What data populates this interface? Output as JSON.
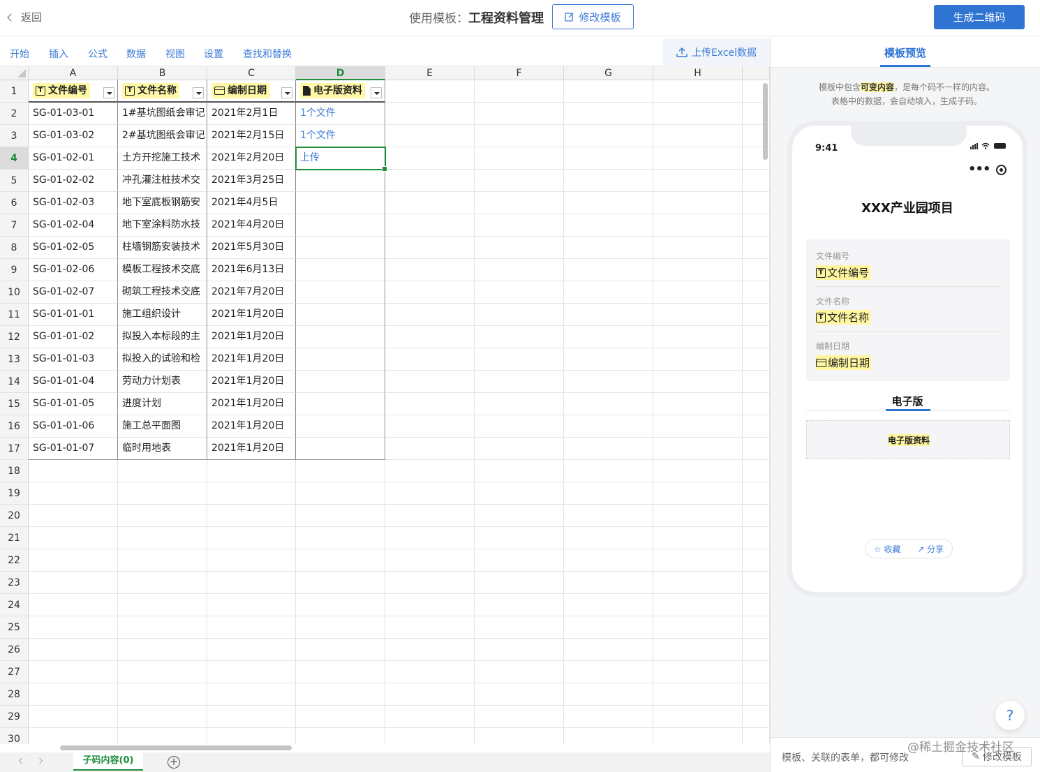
{
  "topbar": {
    "back": "返回",
    "title_prefix": "使用模板：",
    "title": "工程资料管理",
    "edit_template": "修改模板",
    "generate_qr": "生成二维码"
  },
  "menu": {
    "items": [
      "开始",
      "插入",
      "公式",
      "数据",
      "视图",
      "设置",
      "查找和替换"
    ],
    "upload": "上传Excel数据"
  },
  "sheet": {
    "columns": [
      "A",
      "B",
      "C",
      "D",
      "E",
      "F",
      "G",
      "H"
    ],
    "active_column": "D",
    "active_row": 4,
    "headers": [
      {
        "label": "文件编号",
        "icon": "text-icon"
      },
      {
        "label": "文件名称",
        "icon": "text-icon"
      },
      {
        "label": "编制日期",
        "icon": "calendar-icon"
      },
      {
        "label": "电子版资料",
        "icon": "file-icon"
      }
    ],
    "rows": [
      [
        "SG-01-03-01",
        "1#基坑图纸会审记",
        "2021年2月1日",
        "1个文件"
      ],
      [
        "SG-01-03-02",
        "2#基坑图纸会审记",
        "2021年2月15日",
        "1个文件"
      ],
      [
        "SG-01-02-01",
        "土方开挖施工技术",
        "2021年2月20日",
        "上传"
      ],
      [
        "SG-01-02-02",
        "冲孔灌注桩技术交",
        "2021年3月25日",
        ""
      ],
      [
        "SG-01-02-03",
        "地下室底板钢筋安",
        "2021年4月5日",
        ""
      ],
      [
        "SG-01-02-04",
        "地下室涂料防水技",
        "2021年4月20日",
        ""
      ],
      [
        "SG-01-02-05",
        "柱墙钢筋安装技术",
        "2021年5月30日",
        ""
      ],
      [
        "SG-01-02-06",
        "模板工程技术交底",
        "2021年6月13日",
        ""
      ],
      [
        "SG-01-02-07",
        "砌筑工程技术交底",
        "2021年7月20日",
        ""
      ],
      [
        "SG-01-01-01",
        "施工组织设计",
        "2021年1月20日",
        ""
      ],
      [
        "SG-01-01-02",
        "拟投入本标段的主",
        "2021年1月20日",
        ""
      ],
      [
        "SG-01-01-03",
        "拟投入的试验和检",
        "2021年1月20日",
        ""
      ],
      [
        "SG-01-01-04",
        "劳动力计划表",
        "2021年1月20日",
        ""
      ],
      [
        "SG-01-01-05",
        "进度计划",
        "2021年1月20日",
        ""
      ],
      [
        "SG-01-01-06",
        "施工总平面图",
        "2021年1月20日",
        ""
      ],
      [
        "SG-01-01-07",
        "临时用地表",
        "2021年1月20日",
        ""
      ]
    ],
    "total_rows": 30,
    "tab": "子码内容(0)",
    "add_tab": "+"
  },
  "preview": {
    "tab": "模板预览",
    "note_before": "模板中包含",
    "note_highlight": "可变内容",
    "note_after": "，是每个码不一样的内容。",
    "note_line2": "表格中的数据，会自动填入，生成子码。",
    "phone": {
      "time": "9:41",
      "title": "XXX产业园项目",
      "fields": [
        {
          "label": "文件编号",
          "value": "文件编号",
          "icon": "text-icon"
        },
        {
          "label": "文件名称",
          "value": "文件名称",
          "icon": "text-icon"
        },
        {
          "label": "编制日期",
          "value": "编制日期",
          "icon": "calendar-icon"
        }
      ],
      "section": "电子版",
      "file_label": "电子版资料",
      "favorite": "收藏",
      "share": "分享"
    },
    "help": "?",
    "footer_text": "模板、关联的表单，都可修改",
    "footer_button": "修改模板"
  },
  "watermark": "@稀土掘金技术社区",
  "colors": {
    "accent": "#2f74d3",
    "link": "#3d7bd6",
    "selection": "#1f8c3a",
    "highlight": "#fff6a0"
  }
}
